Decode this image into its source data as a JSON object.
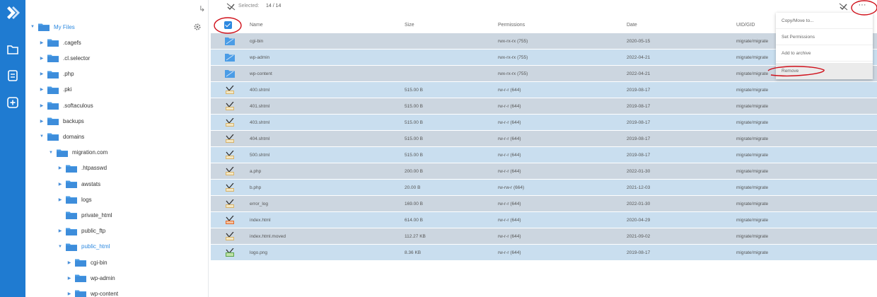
{
  "toolbar": {
    "selected_label": "Selected:",
    "selected_count": "14 / 14",
    "more_label": "···"
  },
  "tree": {
    "items": [
      {
        "label": "My Files",
        "level": 0,
        "arrow": "down",
        "root": true
      },
      {
        "label": ".cagefs",
        "level": 1,
        "arrow": "right"
      },
      {
        "label": ".cl.selector",
        "level": 1,
        "arrow": "right"
      },
      {
        "label": ".php",
        "level": 1,
        "arrow": "right"
      },
      {
        "label": ".pki",
        "level": 1,
        "arrow": "right"
      },
      {
        "label": ".softaculous",
        "level": 1,
        "arrow": "right"
      },
      {
        "label": "backups",
        "level": 1,
        "arrow": "right"
      },
      {
        "label": "domains",
        "level": 1,
        "arrow": "down"
      },
      {
        "label": "migration.com",
        "level": 2,
        "arrow": "down"
      },
      {
        "label": ".htpasswd",
        "level": 3,
        "arrow": "right"
      },
      {
        "label": "awstats",
        "level": 3,
        "arrow": "right"
      },
      {
        "label": "logs",
        "level": 3,
        "arrow": "right"
      },
      {
        "label": "private_html",
        "level": 3,
        "arrow": "none",
        "link": true
      },
      {
        "label": "public_ftp",
        "level": 3,
        "arrow": "right"
      },
      {
        "label": "public_html",
        "level": 3,
        "arrow": "down",
        "active": true
      },
      {
        "label": "cgi-bin",
        "level": 4,
        "arrow": "right"
      },
      {
        "label": "wp-admin",
        "level": 4,
        "arrow": "right"
      },
      {
        "label": "wp-content",
        "level": 4,
        "arrow": "right"
      }
    ]
  },
  "table": {
    "headers": {
      "name": "Name",
      "size": "Size",
      "permissions": "Permissions",
      "date": "Date",
      "owner": "UID/GID"
    },
    "rows": [
      {
        "name": "cgi-bin",
        "size": "",
        "perm": "rwx-rx-rx (755)",
        "date": "2020-05-15",
        "owner": "migrate/migrate",
        "type": "folder"
      },
      {
        "name": "wp-admin",
        "size": "",
        "perm": "rwx-rx-rx (755)",
        "date": "2022-04-21",
        "owner": "migrate/migrate",
        "type": "folder"
      },
      {
        "name": "wp-content",
        "size": "",
        "perm": "rwx-rx-rx (755)",
        "date": "2022-04-21",
        "owner": "migrate/migrate",
        "type": "folder"
      },
      {
        "name": "400.shtml",
        "size": "515.00 B",
        "perm": "rw-r-r (644)",
        "date": "2019-08-17",
        "owner": "migrate/migrate",
        "type": "file"
      },
      {
        "name": "401.shtml",
        "size": "515.00 B",
        "perm": "rw-r-r (644)",
        "date": "2019-08-17",
        "owner": "migrate/migrate",
        "type": "file"
      },
      {
        "name": "403.shtml",
        "size": "515.00 B",
        "perm": "rw-r-r (644)",
        "date": "2019-08-17",
        "owner": "migrate/migrate",
        "type": "file"
      },
      {
        "name": "404.shtml",
        "size": "515.00 B",
        "perm": "rw-r-r (644)",
        "date": "2019-08-17",
        "owner": "migrate/migrate",
        "type": "file"
      },
      {
        "name": "500.shtml",
        "size": "515.00 B",
        "perm": "rw-r-r (644)",
        "date": "2019-08-17",
        "owner": "migrate/migrate",
        "type": "file"
      },
      {
        "name": "a.php",
        "size": "200.00 B",
        "perm": "rw-r-r (644)",
        "date": "2022-01-30",
        "owner": "migrate/migrate",
        "type": "file"
      },
      {
        "name": "b.php",
        "size": "20.00 B",
        "perm": "rw-rw-r (664)",
        "date": "2021-12-03",
        "owner": "migrate/migrate",
        "type": "file"
      },
      {
        "name": "error_log",
        "size": "169.00 B",
        "perm": "rw-r-r (644)",
        "date": "2022-01-30",
        "owner": "migrate/migrate",
        "type": "file"
      },
      {
        "name": "index.html",
        "size": "614.00 B",
        "perm": "rw-r-r (644)",
        "date": "2020-04-29",
        "owner": "migrate/migrate",
        "type": "html"
      },
      {
        "name": "index.html.moved",
        "size": "112.27 KB",
        "perm": "rw-r-r (644)",
        "date": "2021-09-02",
        "owner": "migrate/migrate",
        "type": "file"
      },
      {
        "name": "logo.png",
        "size": "8.36 KB",
        "perm": "rw-r-r (644)",
        "date": "2019-08-17",
        "owner": "migrate/migrate",
        "type": "image"
      }
    ]
  },
  "menu": {
    "items": [
      "Copy/Move to...",
      "Set Permissions",
      "Add to archive",
      "Remove"
    ]
  },
  "colors": {
    "accent": "#1f7bd1",
    "row_odd": "#ccd6e0",
    "row_even": "#c9deef",
    "annotation": "#d0101a"
  }
}
